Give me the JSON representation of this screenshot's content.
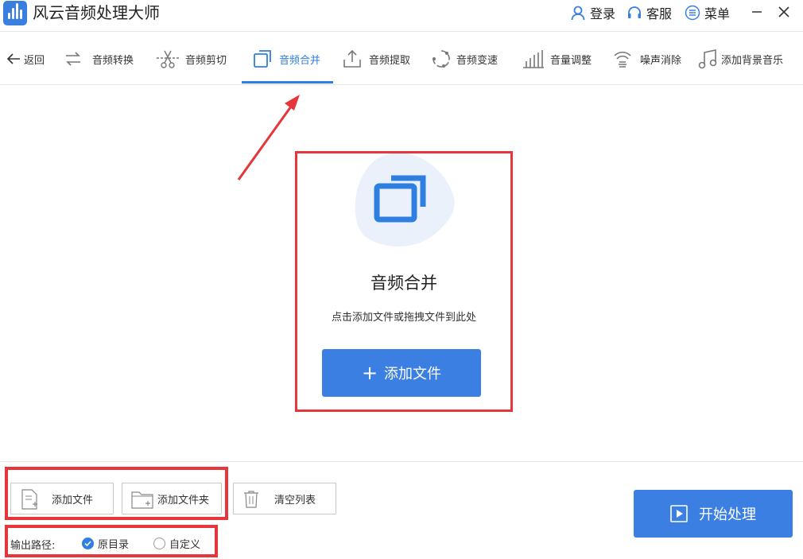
{
  "app": {
    "title": "风云音频处理大师",
    "login": "登录",
    "service": "客服",
    "menu": "菜单"
  },
  "toolbar": {
    "back": "返回",
    "items": [
      {
        "label": "音频转换",
        "icon": "convert-icon"
      },
      {
        "label": "音频剪切",
        "icon": "scissors-icon"
      },
      {
        "label": "音频合并",
        "icon": "merge-icon",
        "active": true
      },
      {
        "label": "音频提取",
        "icon": "upload-icon"
      },
      {
        "label": "音频变速",
        "icon": "speed-icon"
      },
      {
        "label": "音量调整",
        "icon": "volume-bars-icon"
      },
      {
        "label": "噪声消除",
        "icon": "noise-icon"
      },
      {
        "label": "添加背景音乐",
        "icon": "music-note-icon"
      }
    ]
  },
  "dropzone": {
    "title": "音频合并",
    "hint": "点击添加文件或拖拽文件到此处",
    "button": "添加文件"
  },
  "bottom": {
    "add_file": "添加文件",
    "add_folder": "添加文件夹",
    "clear_list": "清空列表",
    "output_path_label": "输出路径:",
    "radio_original": "原目录",
    "radio_custom": "自定义",
    "selected": "原目录",
    "start": "开始处理"
  },
  "colors": {
    "accent": "#3b7fe3",
    "annotation_red": "#e5373b"
  }
}
